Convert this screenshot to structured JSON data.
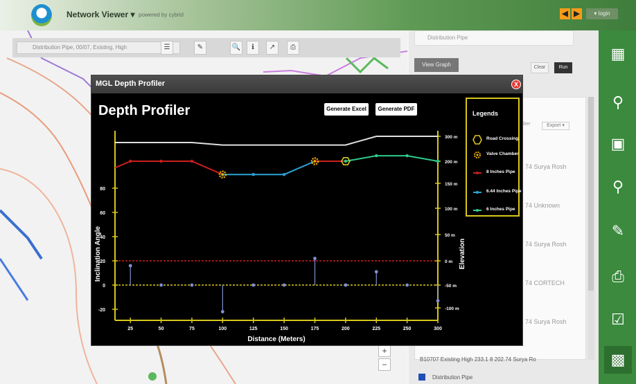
{
  "header": {
    "app_title": "Network Viewer ▾",
    "app_subtitle": "powered by cybrid",
    "user_label": "▾ login",
    "colors": {
      "brand_green": "#3b8a3e",
      "accent_orange": "#f59c1a"
    }
  },
  "map": {
    "search_value": "Distribution Pipe, 00/07, Existing, High",
    "zoom_in": "+",
    "zoom_out": "−"
  },
  "panel": {
    "search_value": "Distribution Pipe",
    "view_graph_label": "View Graph",
    "clear_label": "Clear",
    "run_label": "Run",
    "filter_label": "Filter",
    "export_label": "Export ▾",
    "rows": [
      "74  Surya Rosh",
      "74  Unknown",
      "74  Surya Rosh",
      "74  CORTECH",
      "74  Surya Rosh",
      "74  Surya Rosh"
    ],
    "bottom_row": "B10707  Existing  High  233.1  8  202.74  Surya Ro",
    "bottom_row2": "Distribution Pipe"
  },
  "modal": {
    "title": "MGL Depth Profiler",
    "close_label": "X",
    "heading": "Depth Profiler",
    "generate_excel": "Generate Excel",
    "generate_pdf": "Generate PDF"
  },
  "legend": {
    "title": "Legends",
    "items": [
      {
        "label": "Road Crossing",
        "icon": "hexagon-icon",
        "color": "#d8c81c"
      },
      {
        "label": "Valve Chamber",
        "icon": "gear-icon",
        "color": "#f0b000"
      },
      {
        "label": "8 Inches Pipe",
        "icon": "line-icon",
        "color": "#cc1f1f"
      },
      {
        "label": "6.44 Inches Pipe",
        "icon": "line-icon",
        "color": "#2aa4d6"
      },
      {
        "label": "6 Inches Pipe",
        "icon": "line-icon",
        "color": "#2ecc8a"
      }
    ]
  },
  "chart_data": {
    "type": "line",
    "xlabel": "Distance (Meters)",
    "ylabel_left": "Inclination Angle",
    "ylabel_right": "Elevation",
    "x_ticks": [
      25,
      50,
      75,
      100,
      125,
      150,
      175,
      200,
      225,
      250,
      300
    ],
    "y_left_ticks": [
      80,
      60,
      40,
      20,
      0,
      -20
    ],
    "y_right_ticks": [
      "300 m",
      "200 m",
      "150 m",
      "100 m",
      "50 m",
      "0 m",
      "-50 m",
      "-100 m"
    ],
    "ground_profile": {
      "x": [
        25,
        75,
        100,
        175,
        200,
        225,
        300
      ],
      "elevation": [
        275,
        275,
        265,
        265,
        265,
        300,
        300
      ]
    },
    "series": [
      {
        "name": "8 Inches Pipe",
        "color": "#cc1f1f",
        "x": [
          25,
          50,
          75,
          100
        ],
        "elevation": [
          200,
          200,
          200,
          170
        ]
      },
      {
        "name": "6.44 Inches Pipe",
        "color": "#2aa4d6",
        "x": [
          100,
          125,
          150,
          175
        ],
        "elevation": [
          170,
          170,
          170,
          200
        ]
      },
      {
        "name": "8 Inches Pipe",
        "color": "#cc1f1f",
        "x": [
          175,
          200
        ],
        "elevation": [
          200,
          200
        ]
      },
      {
        "name": "6 Inches Pipe",
        "color": "#2ecc8a",
        "x": [
          200,
          225,
          250,
          300
        ],
        "elevation": [
          200,
          222,
          222,
          200
        ]
      }
    ],
    "markers": [
      {
        "type": "Valve Chamber",
        "x": 100,
        "elevation": 170
      },
      {
        "type": "Valve Chamber",
        "x": 175,
        "elevation": 200
      },
      {
        "type": "Road Crossing",
        "x": 200,
        "elevation": 200
      }
    ],
    "inclination": {
      "x": [
        25,
        50,
        75,
        100,
        125,
        150,
        175,
        200,
        225,
        250,
        300
      ],
      "values": [
        16,
        0,
        0,
        -22,
        0,
        0,
        22,
        0,
        11,
        0,
        -13
      ]
    },
    "reference_lines": {
      "red_dashed": 20,
      "yellow_dashed": 0
    },
    "colors": {
      "axis": "#d8c81c",
      "ground": "#e0e0e0",
      "stems": "#8090d0"
    }
  }
}
